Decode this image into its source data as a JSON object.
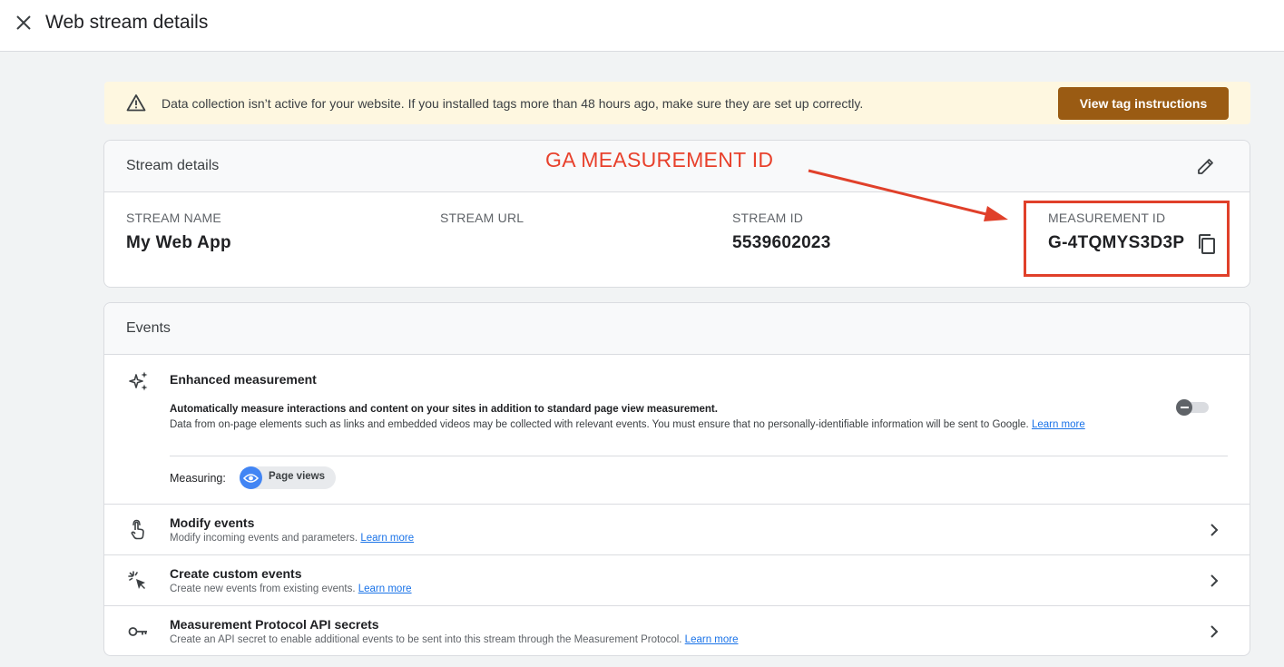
{
  "header": {
    "title": "Web stream details",
    "close_icon": "close-icon"
  },
  "banner": {
    "message": "Data collection isn’t active for your website. If you installed tags more than 48 hours ago, make sure they are set up correctly.",
    "button_label": "View tag instructions",
    "icon": "warning-icon",
    "button_color": "#9a5b13",
    "background_color": "#fef7e0"
  },
  "stream_details": {
    "title": "Stream details",
    "edit_icon": "pencil-icon",
    "fields": [
      {
        "label": "STREAM NAME",
        "value": "My Web App"
      },
      {
        "label": "STREAM URL",
        "value": ""
      },
      {
        "label": "STREAM ID",
        "value": "5539602023"
      },
      {
        "label": "MEASUREMENT ID",
        "value": "G-4TQMYS3D3P"
      }
    ],
    "copy_icon": "copy-icon"
  },
  "annotation": {
    "text": "GA MEASUREMENT ID",
    "color": "#e8412c"
  },
  "events": {
    "title": "Events",
    "enhanced": {
      "title": "Enhanced measurement",
      "desc_bold": "Automatically measure interactions and content on your sites in addition to standard page view measurement.",
      "desc": "Data from on-page elements such as links and embedded videos may be collected with relevant events. You must ensure that no personally-identifiable information will be sent to Google.",
      "learn_more": "Learn more",
      "measuring_label": "Measuring:",
      "chip_label": "Page views",
      "toggle_on": false
    },
    "rows": [
      {
        "title": "Modify events",
        "subtitle": "Modify incoming events and parameters.",
        "link": "Learn more",
        "icon": "touch-icon"
      },
      {
        "title": "Create custom events",
        "subtitle": "Create new events from existing events.",
        "link": "Learn more",
        "icon": "sparkle-click-icon"
      },
      {
        "title": "Measurement Protocol API secrets",
        "subtitle": "Create an API secret to enable additional events to be sent into this stream through the Measurement Protocol.",
        "link": "Learn more",
        "icon": "key-icon"
      }
    ]
  }
}
